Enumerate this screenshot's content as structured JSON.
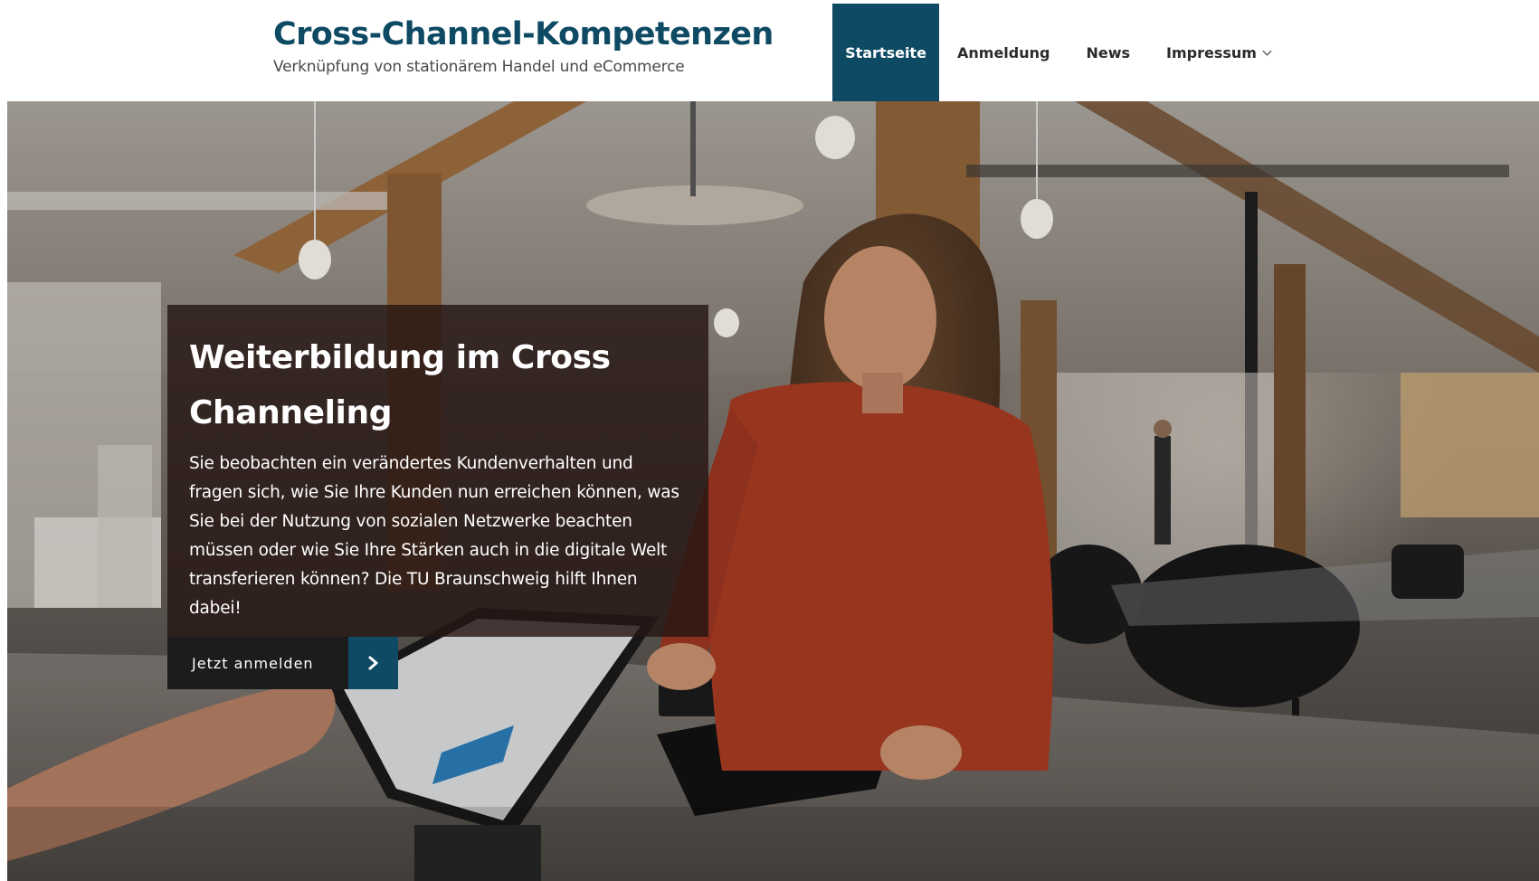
{
  "header": {
    "site_title": "Cross-Channel-Kompetenzen",
    "tagline": "Verknüpfung von stationärem Handel und eCommerce"
  },
  "nav": {
    "items": [
      {
        "label": "Startseite",
        "active": true
      },
      {
        "label": "Anmeldung",
        "active": false
      },
      {
        "label": "News",
        "active": false
      },
      {
        "label": "Impressum",
        "active": false,
        "has_dropdown": true
      }
    ]
  },
  "hero": {
    "heading": "Weiterbildung im Cross Channeling",
    "text": "Sie beobachten ein verändertes Kundenverhalten und fragen sich, wie Sie Ihre Kunden nun erreichen können, was Sie bei der Nutzung von sozialen Netzwerke beachten müssen oder wie Sie Ihre Stärken auch in die digitale Welt transferieren können? Die TU Braunschweig hilft Ihnen dabei!",
    "cta_label": "Jetzt anmelden",
    "cta_icon": "chevron-right-icon"
  },
  "colors": {
    "brand": "#0e4a63",
    "caption_bg": "#26161a",
    "cta_bg": "#1c1c1c"
  }
}
